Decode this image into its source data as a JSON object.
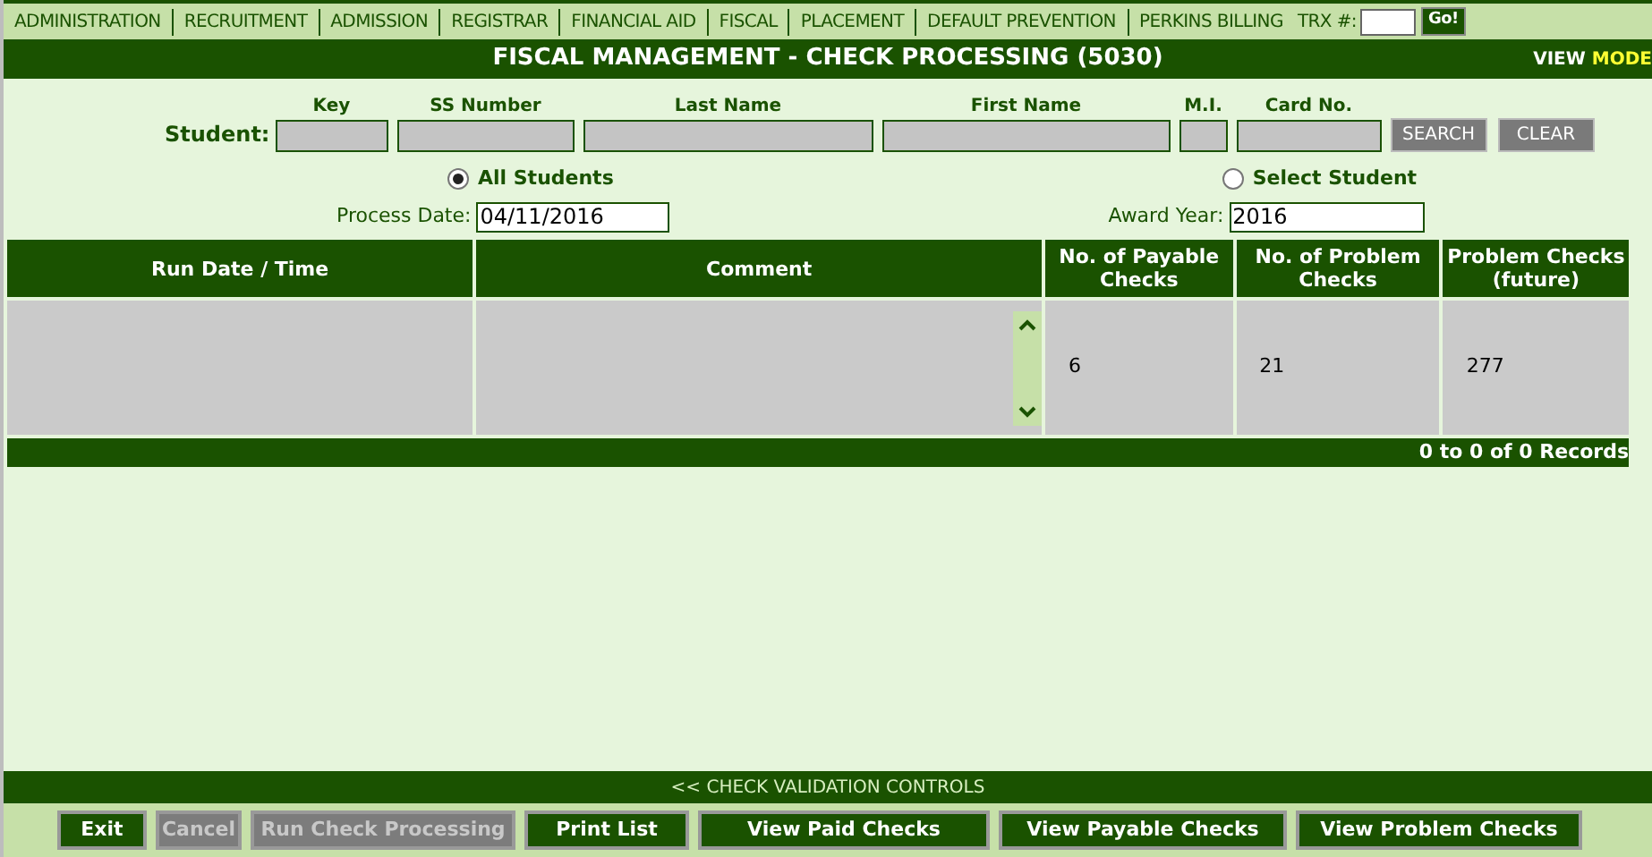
{
  "nav": {
    "items": [
      "ADMINISTRATION",
      "RECRUITMENT",
      "ADMISSION",
      "REGISTRAR",
      "FINANCIAL AID",
      "FISCAL",
      "PLACEMENT",
      "DEFAULT PREVENTION",
      "PERKINS BILLING"
    ],
    "trx_label": "TRX #:",
    "go": "Go!"
  },
  "title": "FISCAL MANAGEMENT - CHECK PROCESSING (5030)",
  "mode_prefix": "VIEW",
  "mode": "MODE",
  "student": {
    "label": "Student:",
    "fields": [
      {
        "label": "Key"
      },
      {
        "label": "SS Number"
      },
      {
        "label": "Last Name"
      },
      {
        "label": "First Name"
      },
      {
        "label": "M.I."
      },
      {
        "label": "Card No."
      }
    ],
    "search": "SEARCH",
    "clear": "CLEAR"
  },
  "scope": [
    {
      "label": "All Students",
      "selected": true
    },
    {
      "label": "Select Student",
      "selected": false
    }
  ],
  "process_date": {
    "label": "Process Date:",
    "value": "04/11/2016"
  },
  "award_year": {
    "label": "Award Year:",
    "value": "2016"
  },
  "table": {
    "columns": [
      "Run Date / Time",
      "Comment",
      "No. of Payable Checks",
      "No. of Problem Checks",
      "Problem Checks (future)"
    ],
    "rows": [
      {
        "cells": [
          null,
          null,
          "6",
          "21",
          "277"
        ]
      }
    ],
    "footer": "0 to 0 of 0 Records"
  },
  "controls_bar": "<< CHECK VALIDATION CONTROLS",
  "buttons": [
    {
      "label": "Exit",
      "disabled": false
    },
    {
      "label": "Cancel",
      "disabled": true
    },
    {
      "label": "Run Check Processing",
      "disabled": true
    },
    {
      "label": "Print List",
      "disabled": false
    },
    {
      "label": "View Paid Checks",
      "disabled": false
    },
    {
      "label": "View Payable Checks",
      "disabled": false
    },
    {
      "label": "View Problem Checks",
      "disabled": false
    }
  ]
}
